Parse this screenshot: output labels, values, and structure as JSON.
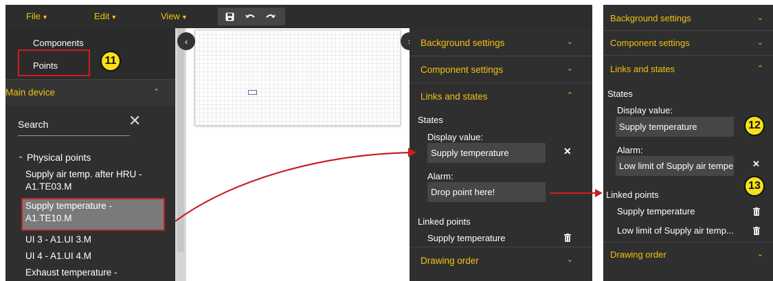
{
  "menubar": {
    "file": "File",
    "edit": "Edit",
    "view": "View"
  },
  "toolbar": {
    "save_icon": "save-icon",
    "undo_icon": "undo-icon",
    "redo_icon": "redo-icon"
  },
  "sidebar": {
    "tabs": [
      "Components",
      "Points"
    ],
    "device_title": "Main device",
    "search_placeholder": "Search",
    "group_label": "Physical points",
    "points": [
      "Supply air temp. after HRU -",
      "A1.TE03.M",
      "Supply temperature -",
      "A1.TE10.M",
      "UI 3 - A1.UI 3.M",
      "UI 4 - A1.UI 4.M",
      "Exhaust temperature -"
    ]
  },
  "callouts": [
    "11",
    "12",
    "13"
  ],
  "panel": {
    "sections": [
      "Background settings",
      "Component settings",
      "Links and states",
      "Drawing order"
    ],
    "states_label": "States",
    "display_value_label": "Display value:",
    "display_value": "Supply temperature",
    "alarm_label": "Alarm:",
    "alarm_value": "Drop point here!",
    "linked_points_label": "Linked points",
    "linked_points": [
      "Supply temperature"
    ]
  },
  "zoom_panel": {
    "sections": [
      "Background settings",
      "Component settings",
      "Links and states",
      "Drawing order"
    ],
    "states_label": "States",
    "display_value_label": "Display value:",
    "display_value": "Supply temperature",
    "alarm_label": "Alarm:",
    "alarm_value": "Low limit of Supply air temper",
    "linked_points_label": "Linked points",
    "linked_points": [
      "Supply temperature",
      "Low limit of Supply air temp..."
    ]
  },
  "colors": {
    "accent": "#f3c20e",
    "panel_bg": "#2f2f2f",
    "highlight_red": "#c71f1f",
    "callout_yellow": "#f7e017"
  }
}
